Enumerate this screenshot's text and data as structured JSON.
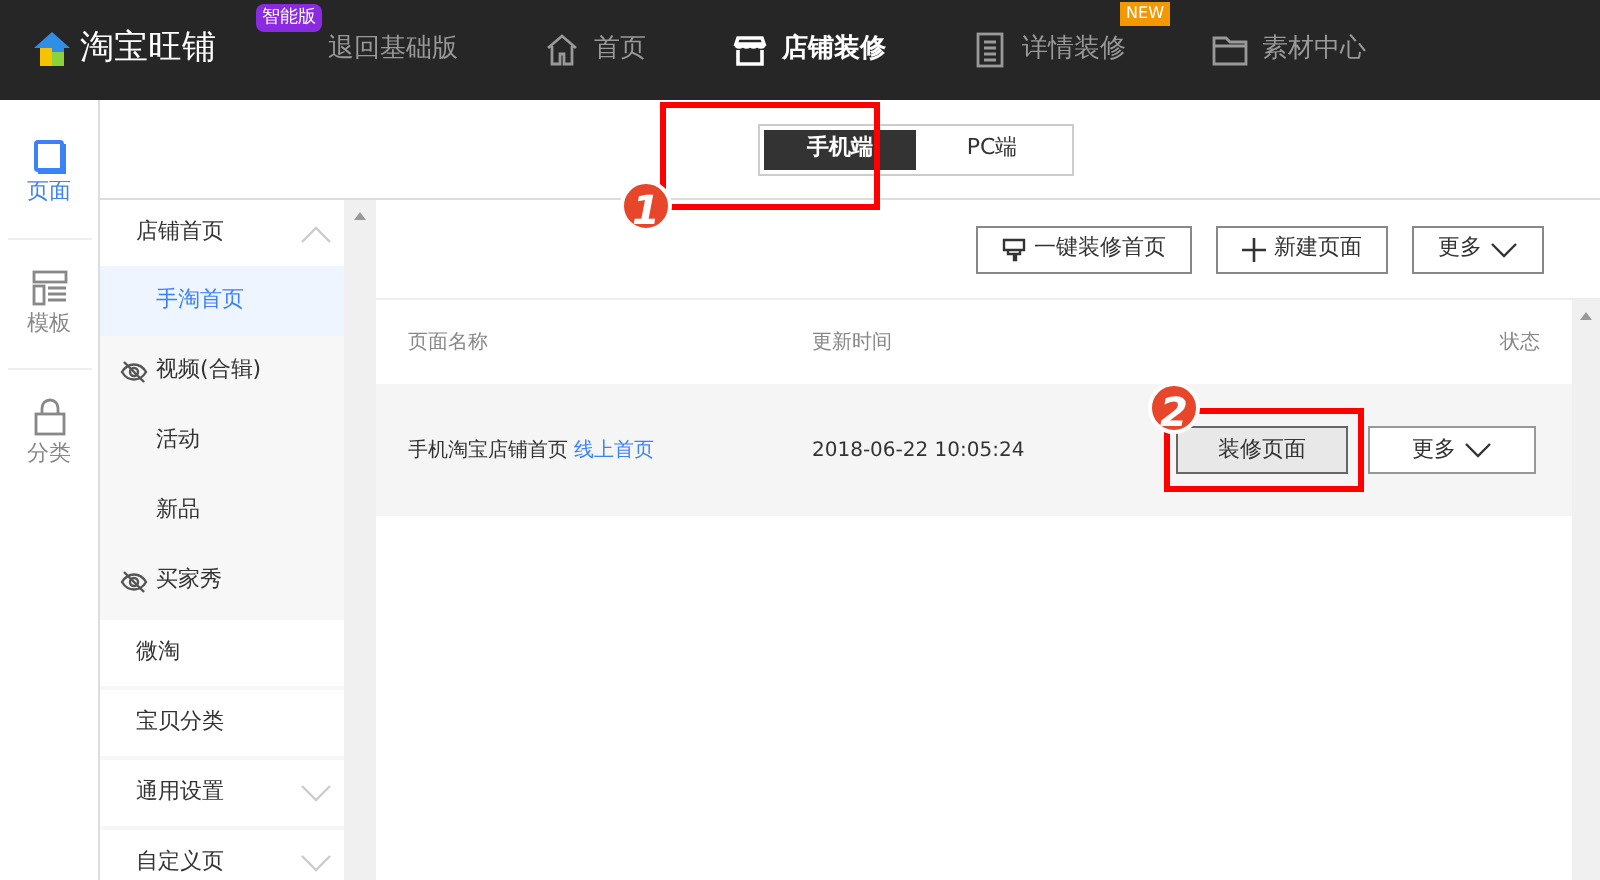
{
  "brand": {
    "name": "淘宝旺铺",
    "badge": "智能版"
  },
  "nav": [
    {
      "label": "退回基础版",
      "kind": "text",
      "selected": false
    },
    {
      "label": "首页",
      "kind": "home",
      "selected": false
    },
    {
      "label": "店铺装修",
      "kind": "store",
      "selected": true
    },
    {
      "label": "详情装修",
      "kind": "list",
      "selected": false,
      "badge": "NEW"
    },
    {
      "label": "素材中心",
      "kind": "folder",
      "selected": false
    }
  ],
  "rail": [
    {
      "label": "页面",
      "kind": "page",
      "selected": true
    },
    {
      "label": "模板",
      "kind": "template",
      "selected": false
    },
    {
      "label": "分类",
      "kind": "bag",
      "selected": false
    }
  ],
  "device_tabs": [
    {
      "label": "手机端",
      "selected": true
    },
    {
      "label": "PC端",
      "selected": false
    }
  ],
  "sidebar": [
    {
      "label": "店铺首页",
      "expanded": true,
      "children": [
        {
          "label": "手淘首页",
          "selected": true,
          "hidden": false
        },
        {
          "label": "视频(合辑)",
          "selected": false,
          "hidden": true
        },
        {
          "label": "活动",
          "selected": false,
          "hidden": false
        },
        {
          "label": "新品",
          "selected": false,
          "hidden": false
        },
        {
          "label": "买家秀",
          "selected": false,
          "hidden": true
        }
      ]
    },
    {
      "label": "微淘"
    },
    {
      "label": "宝贝分类"
    },
    {
      "label": "通用设置",
      "expanded": false
    },
    {
      "label": "自定义页",
      "expanded": false
    }
  ],
  "toolbar": [
    {
      "label": "一键装修首页",
      "kind": "brush"
    },
    {
      "label": "新建页面",
      "kind": "plus"
    },
    {
      "label": "更多",
      "kind": "more"
    }
  ],
  "table": {
    "columns": [
      "页面名称",
      "更新时间",
      "状态"
    ],
    "rows": [
      {
        "name": "手机淘宝店铺首页",
        "tag": "线上首页",
        "time": "2018-06-22 10:05:24",
        "actions": [
          "装修页面",
          "更多"
        ]
      }
    ]
  },
  "annotations": [
    "1",
    "2"
  ]
}
